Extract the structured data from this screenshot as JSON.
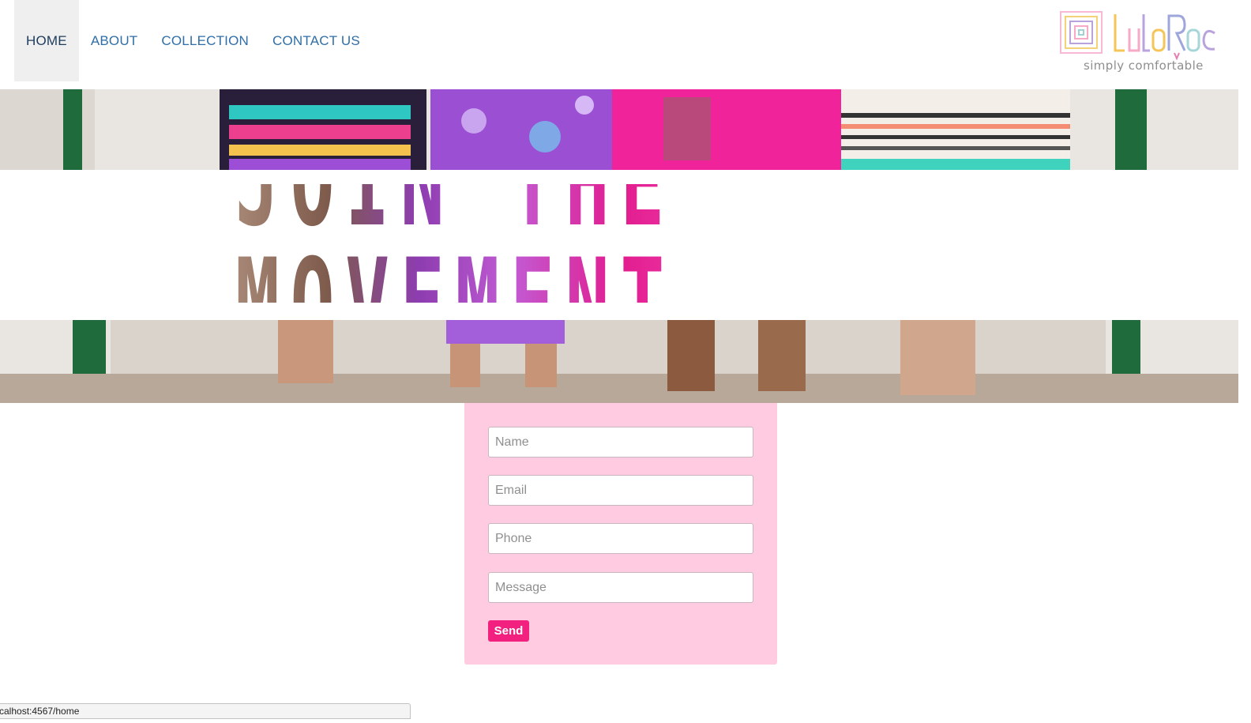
{
  "nav": {
    "items": [
      {
        "label": "HOME",
        "active": true
      },
      {
        "label": "ABOUT",
        "active": false
      },
      {
        "label": "COLLECTION",
        "active": false
      },
      {
        "label": "CONTACT US",
        "active": false
      }
    ]
  },
  "logo": {
    "tagline": "simply comfortable",
    "icon": "lularoe-logo-icon"
  },
  "hero": {
    "headline": "JOIN THE MOVEMENT"
  },
  "form": {
    "name_placeholder": "Name",
    "email_placeholder": "Email",
    "phone_placeholder": "Phone",
    "message_placeholder": "Message",
    "send_label": "Send"
  },
  "statusbar": {
    "url": "calhost:4567/home"
  },
  "colors": {
    "nav_link": "#2f6ea8",
    "nav_active_bg": "#efefef",
    "form_bg": "#fecbe1",
    "send_button": "#f2217f"
  }
}
